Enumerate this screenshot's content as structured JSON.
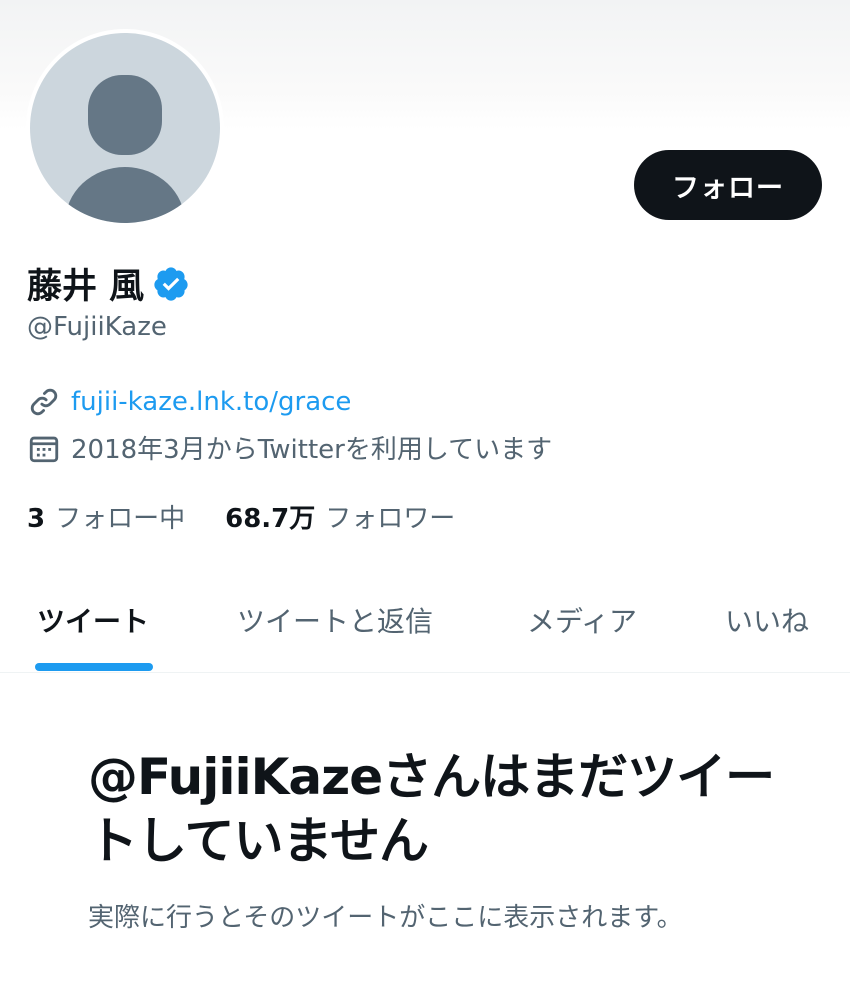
{
  "profile": {
    "display_name": "藤井 風",
    "handle": "@FujiiKaze",
    "link": "fujii-kaze.lnk.to/grace",
    "joined": "2018年3月からTwitterを利用しています",
    "following_count": "3",
    "following_label": "フォロー中",
    "followers_count": "68.7万",
    "followers_label": "フォロワー"
  },
  "actions": {
    "follow_label": "フォロー"
  },
  "tabs": [
    {
      "label": "ツイート",
      "active": true
    },
    {
      "label": "ツイートと返信",
      "active": false
    },
    {
      "label": "メディア",
      "active": false
    },
    {
      "label": "いいね",
      "active": false
    }
  ],
  "empty_state": {
    "title": "@FujiiKazeさんはまだツイートしていません",
    "subtitle": "実際に行うとそのツイートがここに表示されます。"
  },
  "colors": {
    "accent": "#1d9bf0",
    "text_primary": "#0f1419",
    "text_secondary": "#536471",
    "avatar_bg": "#ccd6dd",
    "avatar_fg": "#657786"
  },
  "icons": [
    "verified-badge-icon",
    "link-icon",
    "calendar-icon"
  ]
}
